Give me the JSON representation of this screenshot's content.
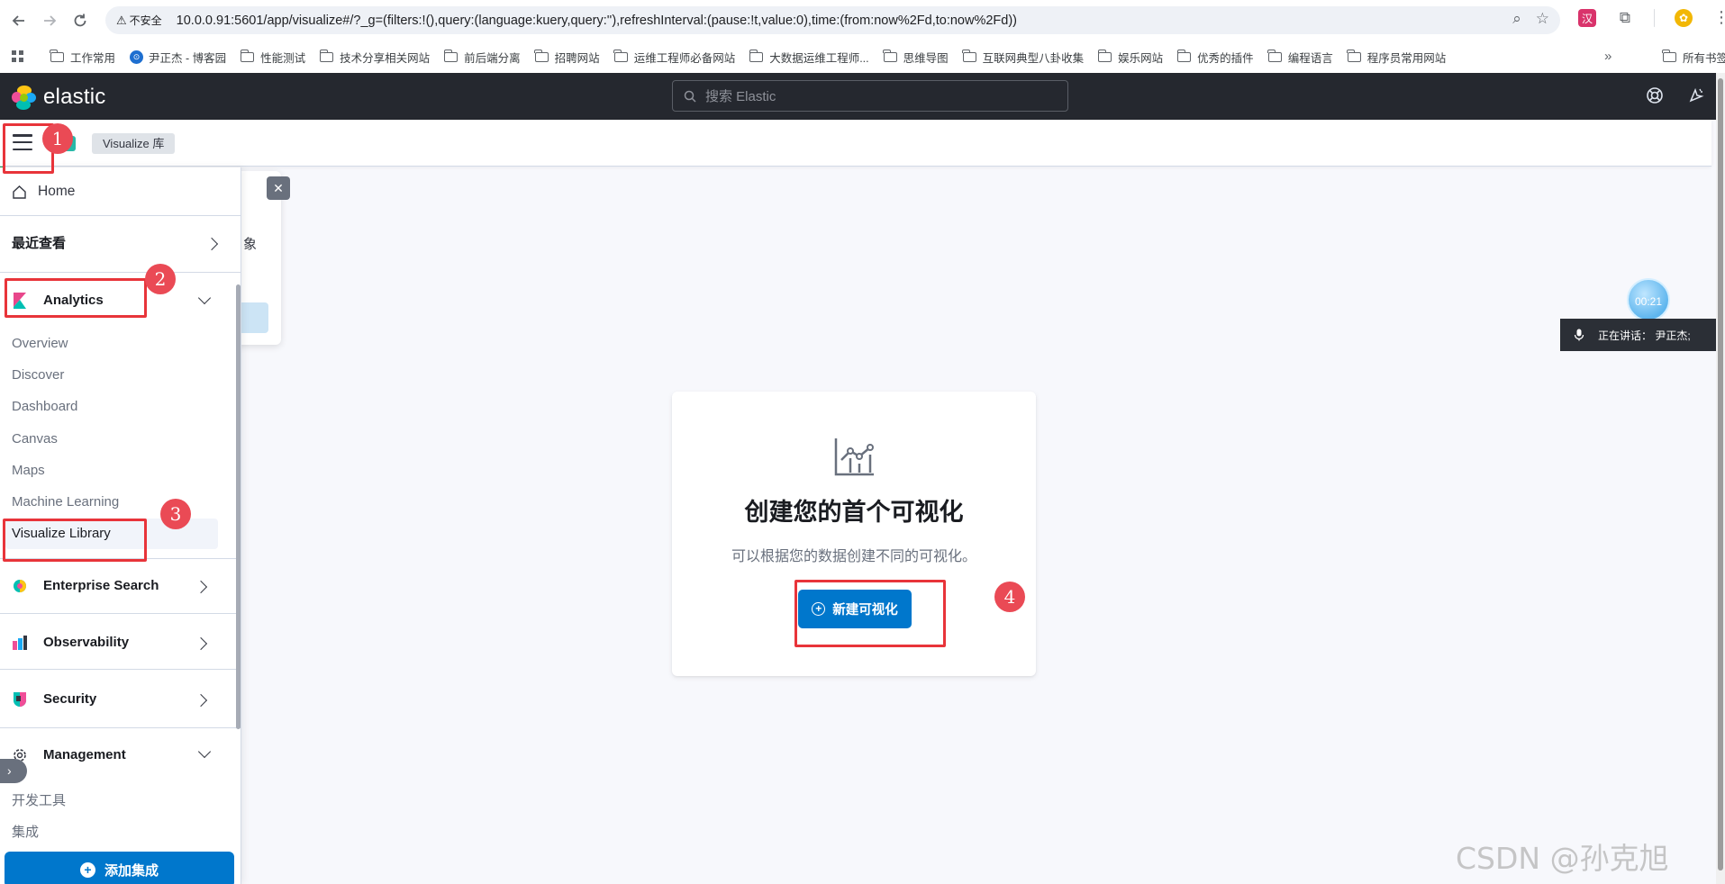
{
  "browser": {
    "insecure_label": "不安全",
    "url": "10.0.0.91:5601/app/visualize#/?_g=(filters:!(),query:(language:kuery,query:''),refreshInterval:(pause:!t,value:0),time:(from:now%2Fd,to:now%2Fd))"
  },
  "bookmarks": {
    "items": [
      "工作常用",
      "尹正杰 - 博客园",
      "性能测试",
      "技术分享相关网站",
      "前后端分离",
      "招聘网站",
      "运维工程师必备网站",
      "大数据运维工程师...",
      "思维导图",
      "互联网典型八卦收集",
      "娱乐网站",
      "优秀的插件",
      "编程语言",
      "程序员常用网站"
    ],
    "all_bookmarks": "所有书签"
  },
  "header": {
    "logo_text": "elastic",
    "search_placeholder": "搜索 Elastic"
  },
  "breadcrumb": "Visualize 库",
  "sidenav": {
    "home": "Home",
    "recent": "最近查看",
    "analytics": {
      "title": "Analytics",
      "items": [
        "Overview",
        "Discover",
        "Dashboard",
        "Canvas",
        "Maps",
        "Machine Learning",
        "Visualize Library"
      ]
    },
    "enterprise_search": "Enterprise Search",
    "observability": "Observability",
    "security": "Security",
    "management": {
      "title": "Management",
      "items": [
        "开发工具",
        "集成"
      ]
    },
    "add_integration": "添加集成"
  },
  "popover": {
    "peek_text": "象"
  },
  "empty_prompt": {
    "title": "创建您的首个可视化",
    "description": "可以根据您的数据创建不同的可视化。",
    "button": "新建可视化"
  },
  "annotations": [
    "1",
    "2",
    "3",
    "4"
  ],
  "widgets": {
    "timer": "00:21",
    "speaking": "正在讲话：  尹正杰;"
  },
  "watermark": "CSDN @孙克旭",
  "colors": {
    "header_bg": "#25282f",
    "primary": "#0077cc",
    "annotation_red": "#e8343a"
  }
}
